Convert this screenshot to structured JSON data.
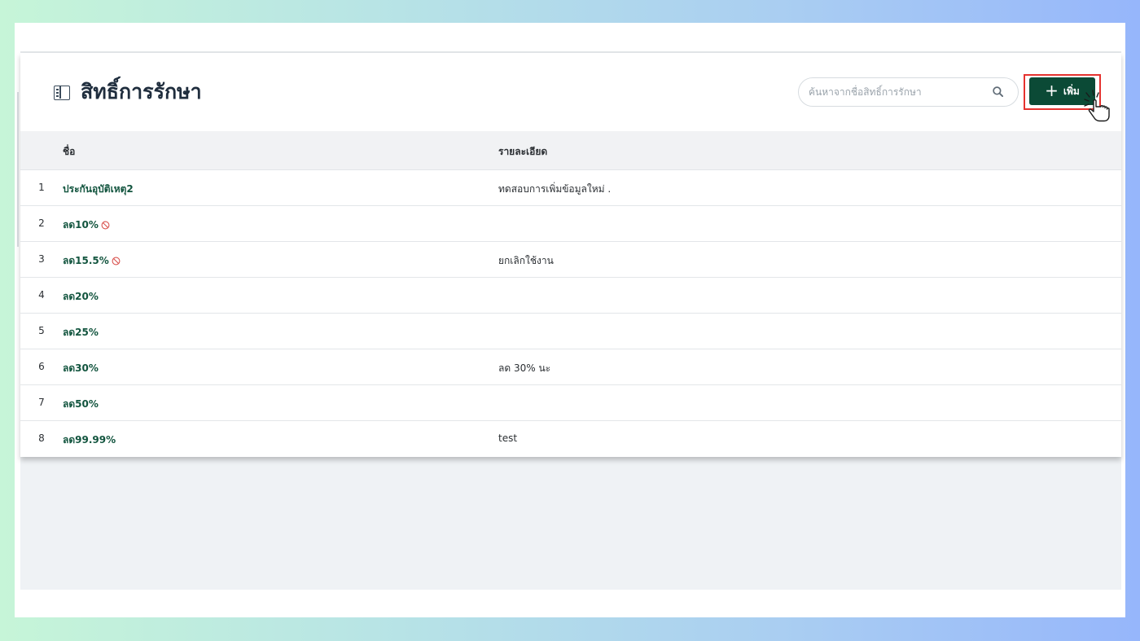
{
  "page": {
    "title": "สิทธิ์การรักษา"
  },
  "search": {
    "placeholder": "ค้นหาจากชื่อสิทธิ์การรักษา",
    "value": ""
  },
  "toolbar": {
    "add_label": "เพิ่ม"
  },
  "table": {
    "columns": [
      "ชื่อ",
      "รายละเอียด"
    ],
    "rows": [
      {
        "no": "1",
        "name": "ประกันอุบัติเหตุ2",
        "disabled": false,
        "description": "ทดสอบการเพิ่มข้อมูลใหม่ ."
      },
      {
        "no": "2",
        "name": "ลด10%",
        "disabled": true,
        "description": ""
      },
      {
        "no": "3",
        "name": "ลด15.5%",
        "disabled": true,
        "description": "ยกเลิกใช้งาน"
      },
      {
        "no": "4",
        "name": "ลด20%",
        "disabled": false,
        "description": ""
      },
      {
        "no": "5",
        "name": "ลด25%",
        "disabled": false,
        "description": ""
      },
      {
        "no": "6",
        "name": "ลด30%",
        "disabled": false,
        "description": "ลด 30% นะ"
      },
      {
        "no": "7",
        "name": "ลด50%",
        "disabled": false,
        "description": ""
      },
      {
        "no": "8",
        "name": "ลด99.99%",
        "disabled": false,
        "description": "test"
      }
    ]
  },
  "colors": {
    "primary": "#0b4a36",
    "link_text": "#13553f",
    "highlight_border": "#e5322f",
    "disabled_icon": "#d9534f"
  },
  "icons": {
    "page": "sidebar-panel-icon",
    "search": "search-icon",
    "add": "plus-icon",
    "disabled": "ban-icon",
    "pointer": "hand-pointer-cursor-icon"
  }
}
